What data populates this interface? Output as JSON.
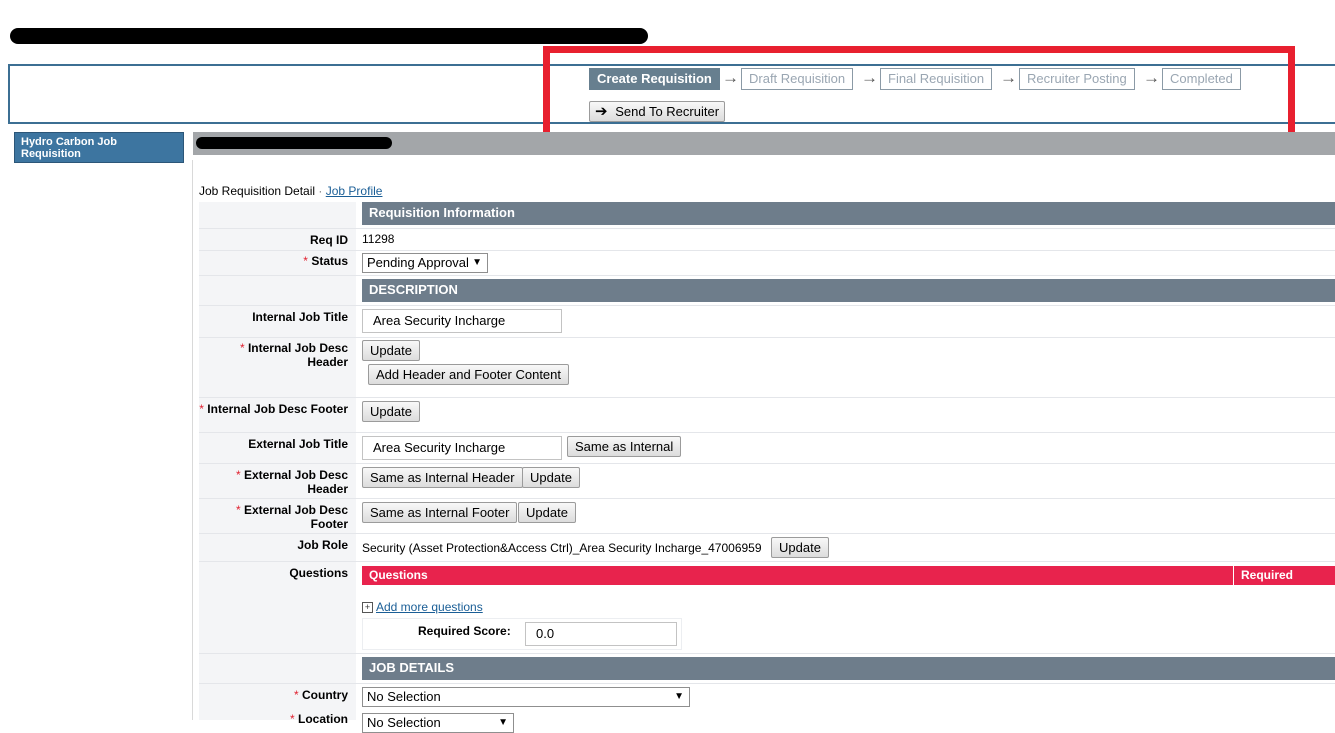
{
  "header": {
    "steps": [
      "Create Requisition",
      "Draft Requisition",
      "Final Requisition",
      "Recruiter Posting",
      "Completed"
    ],
    "send_button": "Send To Recruiter",
    "send_icon": "arrow-right-icon"
  },
  "sidebar": {
    "items": [
      {
        "label": "Hydro Carbon Job Requisition"
      }
    ]
  },
  "breadcrumb": {
    "current": "Job Requisition Detail",
    "separator": "·",
    "link": "Job Profile"
  },
  "sections": {
    "requisition_info": "Requisition Information",
    "description": "DESCRIPTION",
    "job_details": "JOB DETAILS"
  },
  "fields": {
    "req_id": {
      "label": "Req ID",
      "value": "11298"
    },
    "status": {
      "label": "Status",
      "value": "Pending Approval"
    },
    "internal_job_title": {
      "label": "Internal Job Title",
      "value": "Area Security Incharge"
    },
    "internal_desc_header": {
      "label": "Internal Job Desc Header",
      "update": "Update",
      "add": "Add Header and Footer Content"
    },
    "internal_desc_footer": {
      "label": "Internal Job Desc Footer",
      "update": "Update"
    },
    "external_job_title": {
      "label": "External Job Title",
      "value": "Area Security Incharge",
      "same": "Same as Internal"
    },
    "external_desc_header": {
      "label": "External Job Desc Header",
      "same": "Same as Internal Header",
      "update": "Update"
    },
    "external_desc_footer": {
      "label": "External Job Desc Footer",
      "same": "Same as Internal Footer",
      "update": "Update"
    },
    "job_role": {
      "label": "Job Role",
      "value": "Security (Asset Protection&Access Ctrl)_Area Security Incharge_47006959",
      "update": "Update"
    },
    "questions": {
      "label": "Questions",
      "col_questions": "Questions",
      "col_required": "Required",
      "add_more": "Add more questions",
      "add_icon": "plus-box-icon",
      "required_score_label": "Required Score:",
      "required_score_value": "0.0"
    },
    "country": {
      "label": "Country",
      "value": "No Selection"
    },
    "location": {
      "label": "Location",
      "value": "No Selection"
    }
  },
  "colors": {
    "accent_header": "#6e7d8b",
    "questions_bar": "#e8234d",
    "annotation_red": "#e8202f",
    "active_step": "#677f8f"
  }
}
